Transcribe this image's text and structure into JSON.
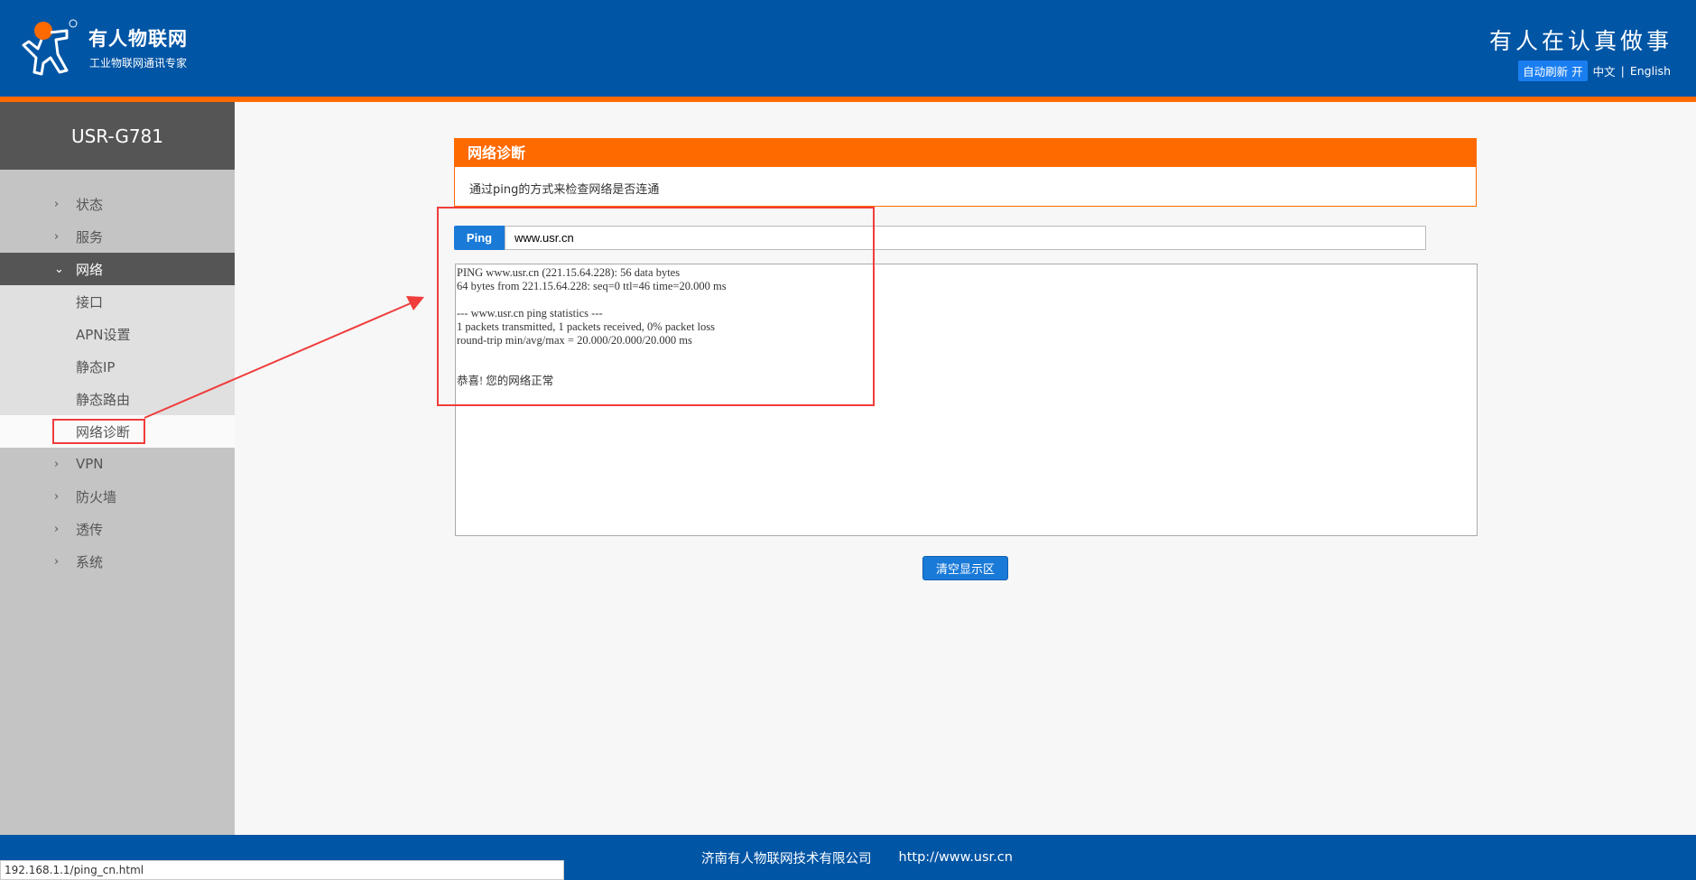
{
  "header": {
    "brand": "有人物联网",
    "brand_sub": "工业物联网通讯专家",
    "slogan": "有人在认真做事",
    "auto_refresh": "自动刷新 开",
    "lang_cn": "中文",
    "sep": "|",
    "lang_en": "English"
  },
  "sidebar": {
    "title": "USR-G781",
    "items": [
      {
        "label": "状态"
      },
      {
        "label": "服务"
      },
      {
        "label": "网络"
      },
      {
        "label": "接口"
      },
      {
        "label": "APN设置"
      },
      {
        "label": "静态IP"
      },
      {
        "label": "静态路由"
      },
      {
        "label": "网络诊断"
      },
      {
        "label": "VPN"
      },
      {
        "label": "防火墙"
      },
      {
        "label": "透传"
      },
      {
        "label": "系统"
      }
    ]
  },
  "panel": {
    "title": "网络诊断",
    "desc": "通过ping的方式来检查网络是否连通"
  },
  "ping": {
    "button": "Ping",
    "value": "www.usr.cn"
  },
  "output": "PING www.usr.cn (221.15.64.228): 56 data bytes\n64 bytes from 221.15.64.228: seq=0 ttl=46 time=20.000 ms\n\n--- www.usr.cn ping statistics ---\n1 packets transmitted, 1 packets received, 0% packet loss\nround-trip min/avg/max = 20.000/20.000/20.000 ms\n\n\n恭喜! 您的网络正常",
  "clear_button": "清空显示区",
  "footer": {
    "company": "济南有人物联网技术有限公司",
    "url": "http://www.usr.cn"
  },
  "status_url": "192.168.1.1/ping_cn.html",
  "colors": {
    "blue": "#0055a5",
    "orange": "#ff6a00",
    "highlight": "#f03c3c"
  }
}
